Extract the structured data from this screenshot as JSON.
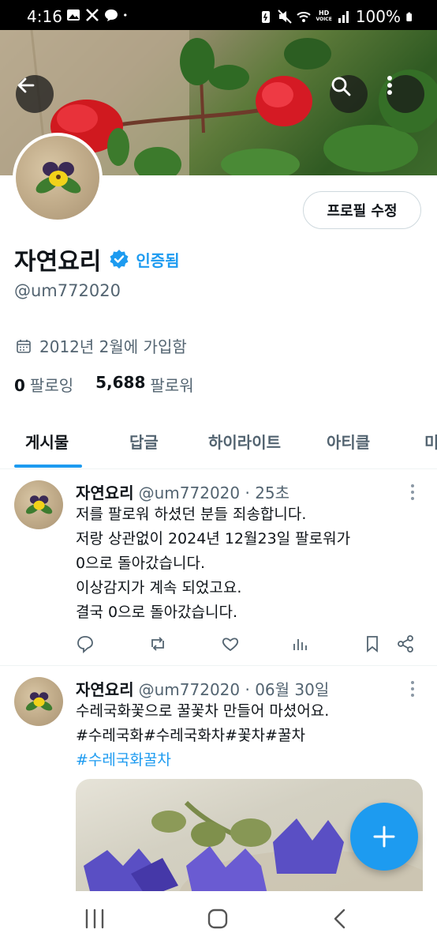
{
  "status_bar": {
    "time": "4:16",
    "battery": "100%",
    "hd_label_top": "HD",
    "hd_label_bottom": "VOICE"
  },
  "profile": {
    "name": "자연요리",
    "verified_label": "인증됨",
    "handle": "@um772020",
    "joined": "2012년 2월에 가입함",
    "following_count": "0",
    "following_label": "팔로잉",
    "followers_count": "5,688",
    "followers_label": "팔로워",
    "edit_button": "프로필 수정"
  },
  "tabs": [
    {
      "label": "게시물",
      "active": true
    },
    {
      "label": "답글",
      "active": false
    },
    {
      "label": "하이라이트",
      "active": false
    },
    {
      "label": "아티클",
      "active": false
    },
    {
      "label": "미",
      "active": false
    }
  ],
  "tweets": [
    {
      "name": "자연요리",
      "meta": "@um772020 · 25초",
      "lines": [
        "저를 팔로워 하셨던 분들 죄송합니다.",
        "저랑 상관없이 2024년 12월23일 팔로워가",
        "0으로 돌아갔습니다.",
        "이상감지가 계속 되었고요.",
        "결국 0으로 돌아갔습니다."
      ]
    },
    {
      "name": "자연요리",
      "meta": "@um772020 · 06월 30일",
      "lines": [
        "수레국화꽃으로 꿀꽃차 만들어 마셨어요.",
        "#수레국화#수레국화차#꽃차#꿀차"
      ],
      "hashtag_link": "#수레국화꿀차"
    }
  ],
  "colors": {
    "accent": "#1d9bf0",
    "text_primary": "#0f1419",
    "text_secondary": "#536471"
  }
}
